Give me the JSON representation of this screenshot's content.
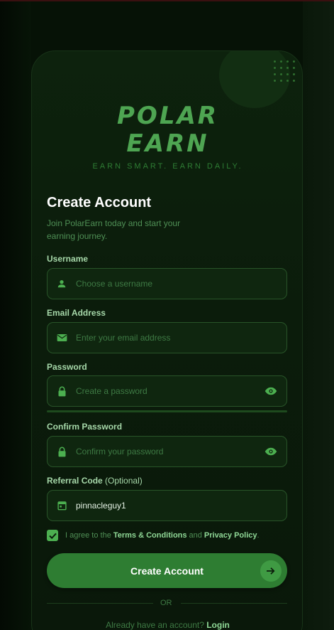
{
  "brand": {
    "line1": "POLAR",
    "line2": "EARN",
    "tagline": "EARN SMART. EARN DAILY."
  },
  "form": {
    "title": "Create Account",
    "subtitle": "Join PolarEarn today and start your earning journey.",
    "username": {
      "label": "Username",
      "placeholder": "Choose a username",
      "value": "",
      "icon": "person-icon"
    },
    "email": {
      "label": "Email Address",
      "placeholder": "Enter your email address",
      "value": "",
      "icon": "email-icon"
    },
    "password": {
      "label": "Password",
      "placeholder": "Create a password",
      "value": "",
      "icon": "lock-icon",
      "toggle_icon": "eye-icon"
    },
    "confirm_password": {
      "label": "Confirm Password",
      "placeholder": "Confirm your password",
      "value": "",
      "icon": "lock-icon",
      "toggle_icon": "eye-icon"
    },
    "referral": {
      "label": "Referral Code",
      "optional": "(Optional)",
      "placeholder": "",
      "value": "pinnacleguy1",
      "icon": "calendar-icon"
    },
    "agreement": {
      "checked": true,
      "prefix": "I agree to the",
      "terms": "Terms & Conditions",
      "and": "and",
      "privacy": "Privacy Policy",
      "suffix": "."
    },
    "submit_label": "Create Account",
    "divider_text": "OR",
    "login_prompt": "Already have an account?",
    "login_link": "Login"
  },
  "colors": {
    "accent": "#4caf50",
    "button": "#2e7d32",
    "background": "#061206"
  }
}
